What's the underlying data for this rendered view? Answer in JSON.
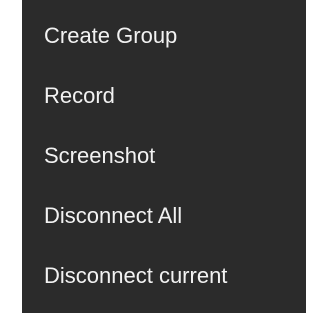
{
  "menu": {
    "background_color": "#2b2b2b",
    "text_color": "#f2f2f2",
    "items": [
      {
        "label": "Create Group"
      },
      {
        "label": "Record"
      },
      {
        "label": "Screenshot"
      },
      {
        "label": "Disconnect All"
      },
      {
        "label": "Disconnect current"
      }
    ]
  }
}
